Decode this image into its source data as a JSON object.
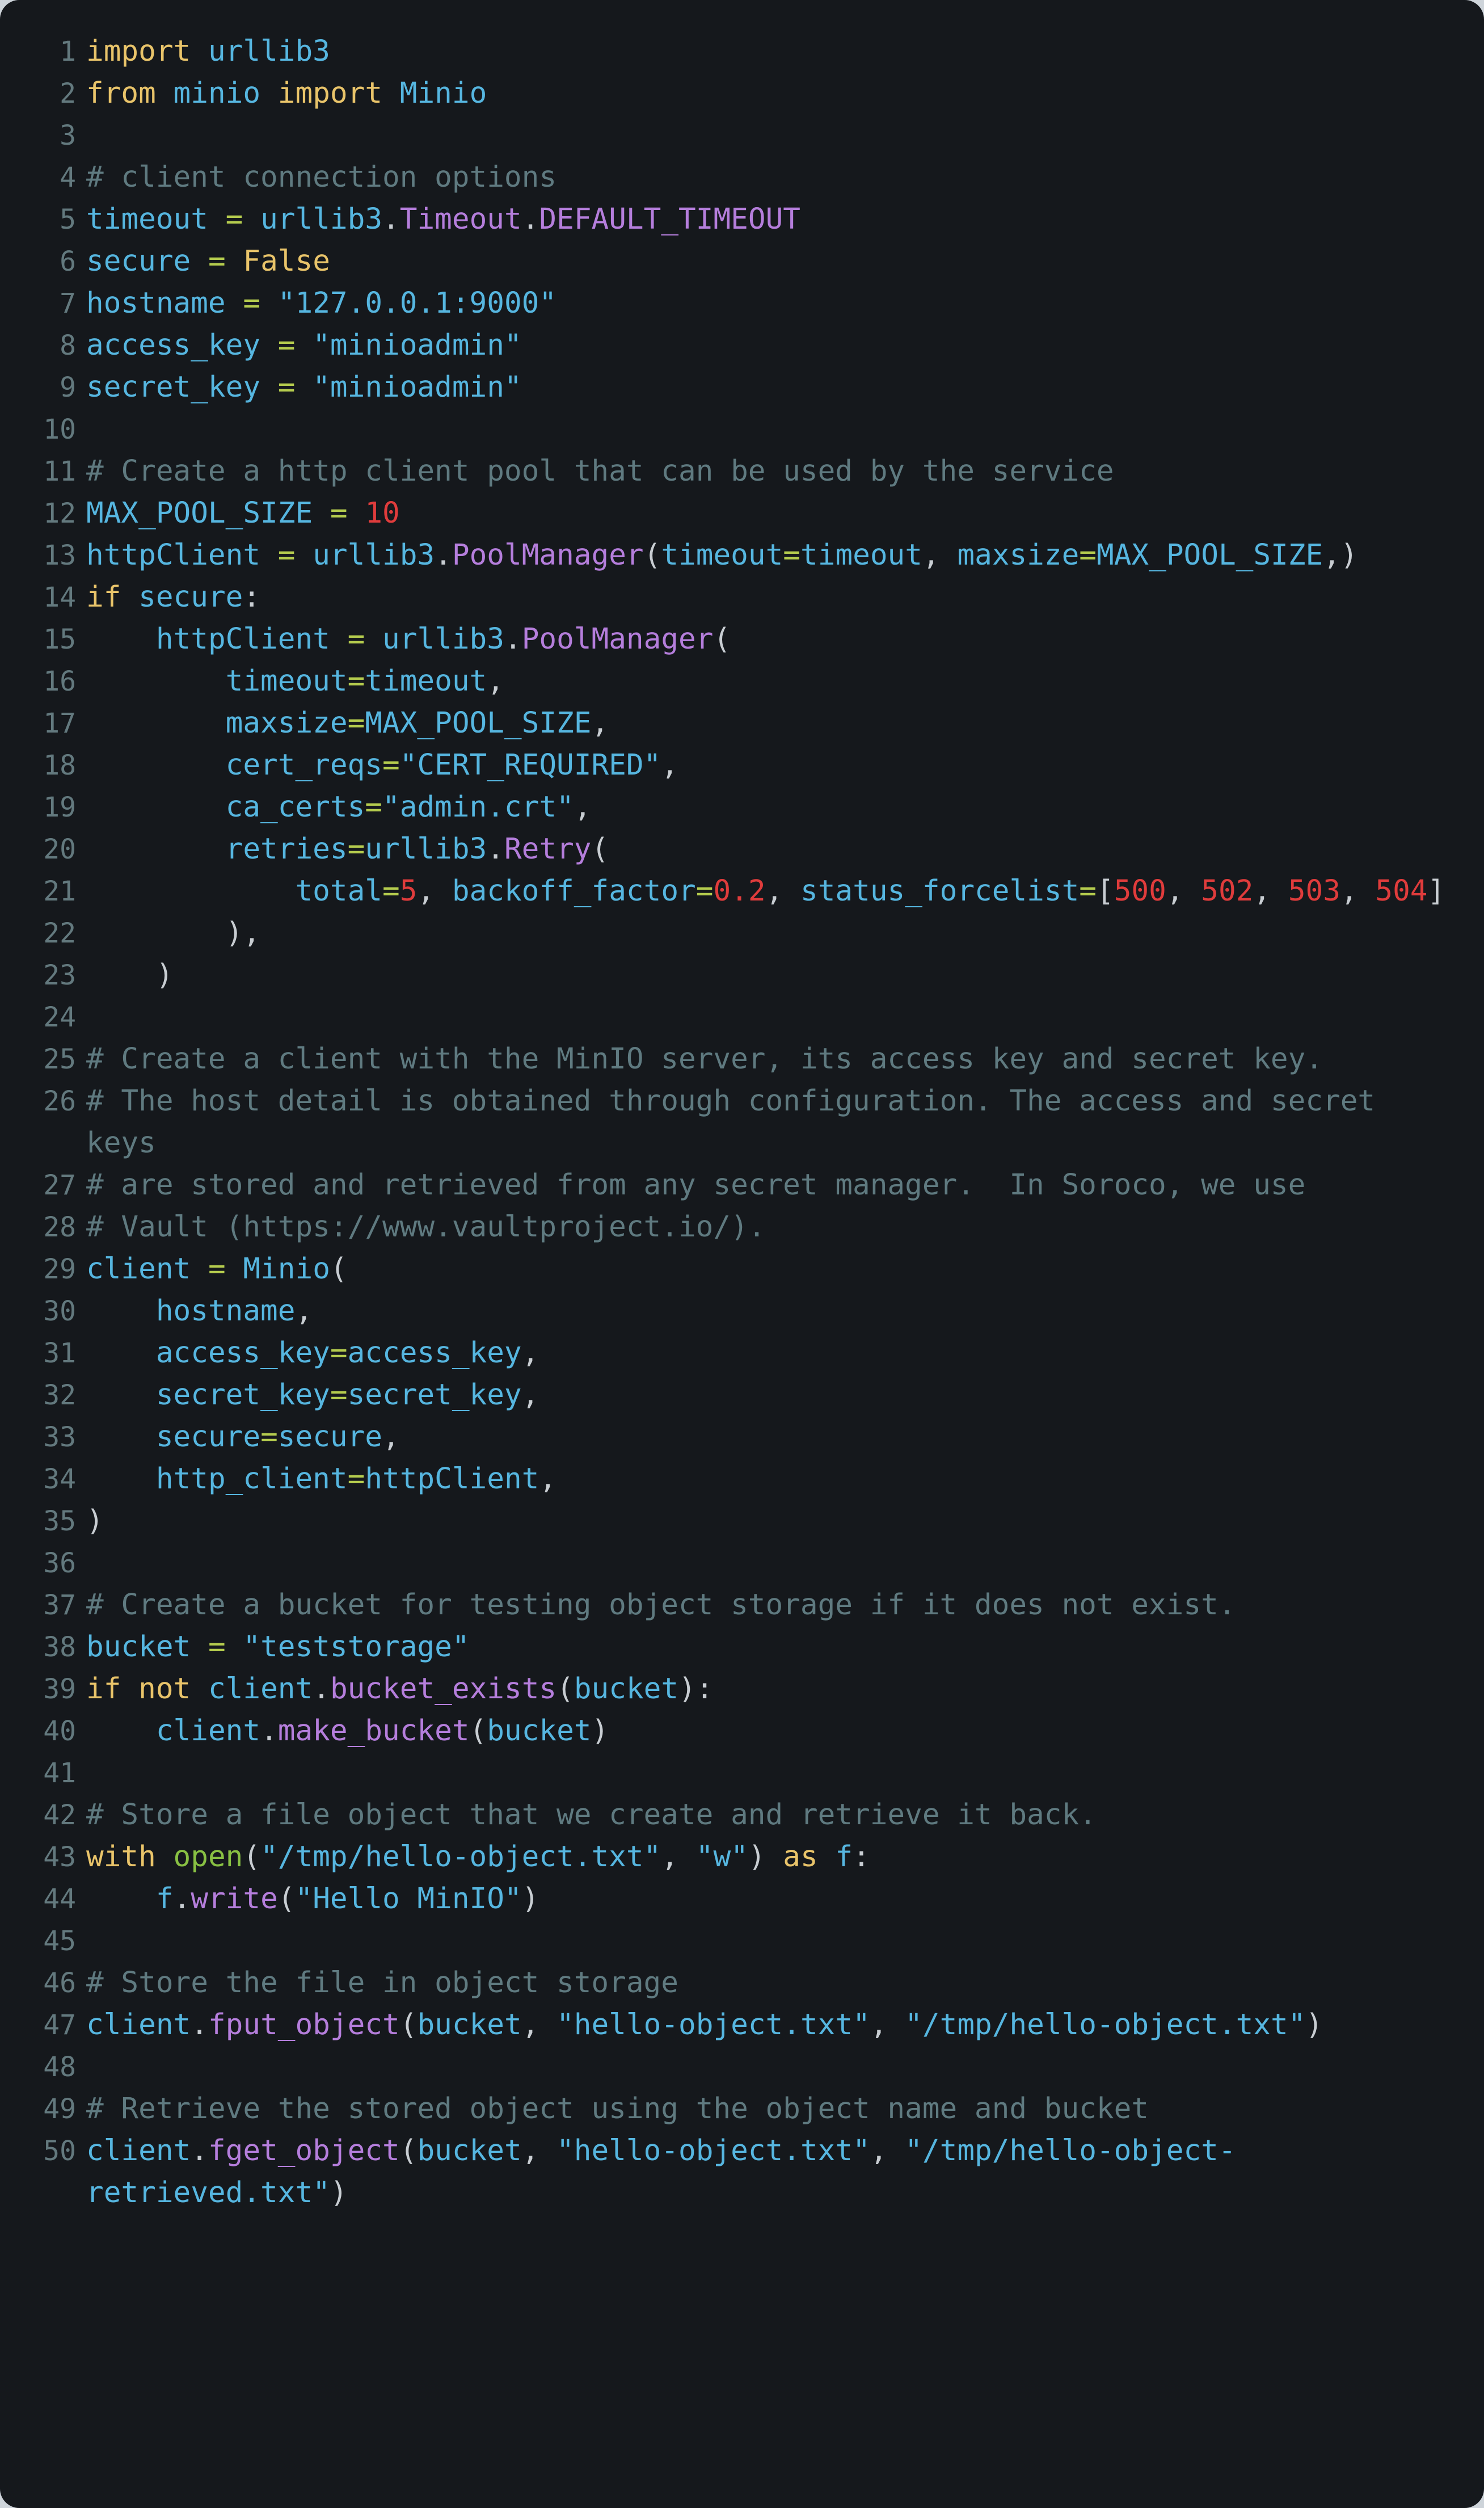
{
  "theme": {
    "background": "#15181c",
    "page_background": "#ced4da",
    "gutter_color": "#63797e",
    "comment": "#5f7a80",
    "keyword": "#e9c46a",
    "name": "#56b6e0",
    "string": "#56b6e0",
    "operator": "#b5cc4e",
    "punctuation": "#c8cdd2",
    "attribute": "#b57edc",
    "number": "#e03c3c",
    "builtin": "#88c043"
  },
  "code": {
    "language": "python",
    "first_line": 1,
    "last_line": 50,
    "lines": [
      {
        "n": "1",
        "text": "import urllib3"
      },
      {
        "n": "2",
        "text": "from minio import Minio"
      },
      {
        "n": "3",
        "text": ""
      },
      {
        "n": "4",
        "text": "# client connection options"
      },
      {
        "n": "5",
        "text": "timeout = urllib3.Timeout.DEFAULT_TIMEOUT"
      },
      {
        "n": "6",
        "text": "secure = False"
      },
      {
        "n": "7",
        "text": "hostname = \"127.0.0.1:9000\""
      },
      {
        "n": "8",
        "text": "access_key = \"minioadmin\""
      },
      {
        "n": "9",
        "text": "secret_key = \"minioadmin\""
      },
      {
        "n": "10",
        "text": ""
      },
      {
        "n": "11",
        "text": "# Create a http client pool that can be used by the service"
      },
      {
        "n": "12",
        "text": "MAX_POOL_SIZE = 10"
      },
      {
        "n": "13",
        "text": "httpClient = urllib3.PoolManager(timeout=timeout, maxsize=MAX_POOL_SIZE,)"
      },
      {
        "n": "14",
        "text": "if secure:"
      },
      {
        "n": "15",
        "text": "    httpClient = urllib3.PoolManager("
      },
      {
        "n": "16",
        "text": "        timeout=timeout,"
      },
      {
        "n": "17",
        "text": "        maxsize=MAX_POOL_SIZE,"
      },
      {
        "n": "18",
        "text": "        cert_reqs=\"CERT_REQUIRED\","
      },
      {
        "n": "19",
        "text": "        ca_certs=\"admin.crt\","
      },
      {
        "n": "20",
        "text": "        retries=urllib3.Retry("
      },
      {
        "n": "21",
        "text": "            total=5, backoff_factor=0.2, status_forcelist=[500, 502, 503, 504]"
      },
      {
        "n": "22",
        "text": "        ),"
      },
      {
        "n": "23",
        "text": "    )"
      },
      {
        "n": "24",
        "text": ""
      },
      {
        "n": "25",
        "text": "# Create a client with the MinIO server, its access key and secret key."
      },
      {
        "n": "26",
        "text": "# The host detail is obtained through configuration. The access and secret keys"
      },
      {
        "n": "27",
        "text": "# are stored and retrieved from any secret manager.  In Soroco, we use"
      },
      {
        "n": "28",
        "text": "# Vault (https://www.vaultproject.io/)."
      },
      {
        "n": "29",
        "text": "client = Minio("
      },
      {
        "n": "30",
        "text": "    hostname,"
      },
      {
        "n": "31",
        "text": "    access_key=access_key,"
      },
      {
        "n": "32",
        "text": "    secret_key=secret_key,"
      },
      {
        "n": "33",
        "text": "    secure=secure,"
      },
      {
        "n": "34",
        "text": "    http_client=httpClient,"
      },
      {
        "n": "35",
        "text": ")"
      },
      {
        "n": "36",
        "text": ""
      },
      {
        "n": "37",
        "text": "# Create a bucket for testing object storage if it does not exist."
      },
      {
        "n": "38",
        "text": "bucket = \"teststorage\""
      },
      {
        "n": "39",
        "text": "if not client.bucket_exists(bucket):"
      },
      {
        "n": "40",
        "text": "    client.make_bucket(bucket)"
      },
      {
        "n": "41",
        "text": ""
      },
      {
        "n": "42",
        "text": "# Store a file object that we create and retrieve it back."
      },
      {
        "n": "43",
        "text": "with open(\"/tmp/hello-object.txt\", \"w\") as f:"
      },
      {
        "n": "44",
        "text": "    f.write(\"Hello MinIO\")"
      },
      {
        "n": "45",
        "text": ""
      },
      {
        "n": "46",
        "text": "# Store the file in object storage"
      },
      {
        "n": "47",
        "text": "client.fput_object(bucket, \"hello-object.txt\", \"/tmp/hello-object.txt\")"
      },
      {
        "n": "48",
        "text": ""
      },
      {
        "n": "49",
        "text": "# Retrieve the stored object using the object name and bucket"
      },
      {
        "n": "50",
        "text": "client.fget_object(bucket, \"hello-object.txt\", \"/tmp/hello-object-retrieved.txt\")"
      }
    ],
    "tokens": [
      [
        [
          "k",
          "import"
        ],
        [
          "p",
          " "
        ],
        [
          "n",
          "urllib3"
        ]
      ],
      [
        [
          "k",
          "from"
        ],
        [
          "p",
          " "
        ],
        [
          "n",
          "minio"
        ],
        [
          "p",
          " "
        ],
        [
          "k",
          "import"
        ],
        [
          "p",
          " "
        ],
        [
          "n",
          "Minio"
        ]
      ],
      [],
      [
        [
          "c",
          "# client connection options"
        ]
      ],
      [
        [
          "n",
          "timeout"
        ],
        [
          "p",
          " "
        ],
        [
          "o",
          "="
        ],
        [
          "p",
          " "
        ],
        [
          "n",
          "urllib3"
        ],
        [
          "p",
          "."
        ],
        [
          "a",
          "Timeout"
        ],
        [
          "p",
          "."
        ],
        [
          "a",
          "DEFAULT_TIMEOUT"
        ]
      ],
      [
        [
          "n",
          "secure"
        ],
        [
          "p",
          " "
        ],
        [
          "o",
          "="
        ],
        [
          "p",
          " "
        ],
        [
          "kc",
          "False"
        ]
      ],
      [
        [
          "n",
          "hostname"
        ],
        [
          "p",
          " "
        ],
        [
          "o",
          "="
        ],
        [
          "p",
          " "
        ],
        [
          "s",
          "\"127.0.0.1:9000\""
        ]
      ],
      [
        [
          "n",
          "access_key"
        ],
        [
          "p",
          " "
        ],
        [
          "o",
          "="
        ],
        [
          "p",
          " "
        ],
        [
          "s",
          "\"minioadmin\""
        ]
      ],
      [
        [
          "n",
          "secret_key"
        ],
        [
          "p",
          " "
        ],
        [
          "o",
          "="
        ],
        [
          "p",
          " "
        ],
        [
          "s",
          "\"minioadmin\""
        ]
      ],
      [],
      [
        [
          "c",
          "# Create a http client pool that can be used by the service"
        ]
      ],
      [
        [
          "n",
          "MAX_POOL_SIZE"
        ],
        [
          "p",
          " "
        ],
        [
          "o",
          "="
        ],
        [
          "p",
          " "
        ],
        [
          "m",
          "10"
        ]
      ],
      [
        [
          "n",
          "httpClient"
        ],
        [
          "p",
          " "
        ],
        [
          "o",
          "="
        ],
        [
          "p",
          " "
        ],
        [
          "n",
          "urllib3"
        ],
        [
          "p",
          "."
        ],
        [
          "a",
          "PoolManager"
        ],
        [
          "p",
          "("
        ],
        [
          "n",
          "timeout"
        ],
        [
          "o",
          "="
        ],
        [
          "n",
          "timeout"
        ],
        [
          "p",
          ", "
        ],
        [
          "n",
          "maxsize"
        ],
        [
          "o",
          "="
        ],
        [
          "n",
          "MAX_POOL_SIZE"
        ],
        [
          "p",
          ",)"
        ]
      ],
      [
        [
          "k",
          "if"
        ],
        [
          "p",
          " "
        ],
        [
          "n",
          "secure"
        ],
        [
          "p",
          ":"
        ]
      ],
      [
        [
          "p",
          "    "
        ],
        [
          "n",
          "httpClient"
        ],
        [
          "p",
          " "
        ],
        [
          "o",
          "="
        ],
        [
          "p",
          " "
        ],
        [
          "n",
          "urllib3"
        ],
        [
          "p",
          "."
        ],
        [
          "a",
          "PoolManager"
        ],
        [
          "p",
          "("
        ]
      ],
      [
        [
          "p",
          "        "
        ],
        [
          "n",
          "timeout"
        ],
        [
          "o",
          "="
        ],
        [
          "n",
          "timeout"
        ],
        [
          "p",
          ","
        ]
      ],
      [
        [
          "p",
          "        "
        ],
        [
          "n",
          "maxsize"
        ],
        [
          "o",
          "="
        ],
        [
          "n",
          "MAX_POOL_SIZE"
        ],
        [
          "p",
          ","
        ]
      ],
      [
        [
          "p",
          "        "
        ],
        [
          "n",
          "cert_reqs"
        ],
        [
          "o",
          "="
        ],
        [
          "s",
          "\"CERT_REQUIRED\""
        ],
        [
          "p",
          ","
        ]
      ],
      [
        [
          "p",
          "        "
        ],
        [
          "n",
          "ca_certs"
        ],
        [
          "o",
          "="
        ],
        [
          "s",
          "\"admin.crt\""
        ],
        [
          "p",
          ","
        ]
      ],
      [
        [
          "p",
          "        "
        ],
        [
          "n",
          "retries"
        ],
        [
          "o",
          "="
        ],
        [
          "n",
          "urllib3"
        ],
        [
          "p",
          "."
        ],
        [
          "a",
          "Retry"
        ],
        [
          "p",
          "("
        ]
      ],
      [
        [
          "p",
          "            "
        ],
        [
          "n",
          "total"
        ],
        [
          "o",
          "="
        ],
        [
          "m",
          "5"
        ],
        [
          "p",
          ", "
        ],
        [
          "n",
          "backoff_factor"
        ],
        [
          "o",
          "="
        ],
        [
          "m",
          "0.2"
        ],
        [
          "p",
          ", "
        ],
        [
          "n",
          "status_forcelist"
        ],
        [
          "o",
          "="
        ],
        [
          "p",
          "["
        ],
        [
          "m",
          "500"
        ],
        [
          "p",
          ", "
        ],
        [
          "m",
          "502"
        ],
        [
          "p",
          ", "
        ],
        [
          "m",
          "503"
        ],
        [
          "p",
          ", "
        ],
        [
          "m",
          "504"
        ],
        [
          "p",
          "]"
        ]
      ],
      [
        [
          "p",
          "        ),"
        ]
      ],
      [
        [
          "p",
          "    )"
        ]
      ],
      [],
      [
        [
          "c",
          "# Create a client with the MinIO server, its access key and secret key."
        ]
      ],
      [
        [
          "c",
          "# The host detail is obtained through configuration. The access and secret keys"
        ]
      ],
      [
        [
          "c",
          "# are stored and retrieved from any secret manager.  In Soroco, we use"
        ]
      ],
      [
        [
          "c",
          "# Vault (https://www.vaultproject.io/)."
        ]
      ],
      [
        [
          "n",
          "client"
        ],
        [
          "p",
          " "
        ],
        [
          "o",
          "="
        ],
        [
          "p",
          " "
        ],
        [
          "n",
          "Minio"
        ],
        [
          "p",
          "("
        ]
      ],
      [
        [
          "p",
          "    "
        ],
        [
          "n",
          "hostname"
        ],
        [
          "p",
          ","
        ]
      ],
      [
        [
          "p",
          "    "
        ],
        [
          "n",
          "access_key"
        ],
        [
          "o",
          "="
        ],
        [
          "n",
          "access_key"
        ],
        [
          "p",
          ","
        ]
      ],
      [
        [
          "p",
          "    "
        ],
        [
          "n",
          "secret_key"
        ],
        [
          "o",
          "="
        ],
        [
          "n",
          "secret_key"
        ],
        [
          "p",
          ","
        ]
      ],
      [
        [
          "p",
          "    "
        ],
        [
          "n",
          "secure"
        ],
        [
          "o",
          "="
        ],
        [
          "n",
          "secure"
        ],
        [
          "p",
          ","
        ]
      ],
      [
        [
          "p",
          "    "
        ],
        [
          "n",
          "http_client"
        ],
        [
          "o",
          "="
        ],
        [
          "n",
          "httpClient"
        ],
        [
          "p",
          ","
        ]
      ],
      [
        [
          "p",
          ")"
        ]
      ],
      [],
      [
        [
          "c",
          "# Create a bucket for testing object storage if it does not exist."
        ]
      ],
      [
        [
          "n",
          "bucket"
        ],
        [
          "p",
          " "
        ],
        [
          "o",
          "="
        ],
        [
          "p",
          " "
        ],
        [
          "s",
          "\"teststorage\""
        ]
      ],
      [
        [
          "k",
          "if"
        ],
        [
          "p",
          " "
        ],
        [
          "k",
          "not"
        ],
        [
          "p",
          " "
        ],
        [
          "n",
          "client"
        ],
        [
          "p",
          "."
        ],
        [
          "a",
          "bucket_exists"
        ],
        [
          "p",
          "("
        ],
        [
          "n",
          "bucket"
        ],
        [
          "p",
          "):"
        ]
      ],
      [
        [
          "p",
          "    "
        ],
        [
          "n",
          "client"
        ],
        [
          "p",
          "."
        ],
        [
          "a",
          "make_bucket"
        ],
        [
          "p",
          "("
        ],
        [
          "n",
          "bucket"
        ],
        [
          "p",
          ")"
        ]
      ],
      [],
      [
        [
          "c",
          "# Store a file object that we create and retrieve it back."
        ]
      ],
      [
        [
          "k",
          "with"
        ],
        [
          "p",
          " "
        ],
        [
          "b",
          "open"
        ],
        [
          "p",
          "("
        ],
        [
          "s",
          "\"/tmp/hello-object.txt\""
        ],
        [
          "p",
          ", "
        ],
        [
          "s",
          "\"w\""
        ],
        [
          "p",
          ") "
        ],
        [
          "k",
          "as"
        ],
        [
          "p",
          " "
        ],
        [
          "n",
          "f"
        ],
        [
          "p",
          ":"
        ]
      ],
      [
        [
          "p",
          "    "
        ],
        [
          "n",
          "f"
        ],
        [
          "p",
          "."
        ],
        [
          "a",
          "write"
        ],
        [
          "p",
          "("
        ],
        [
          "s",
          "\"Hello MinIO\""
        ],
        [
          "p",
          ")"
        ]
      ],
      [],
      [
        [
          "c",
          "# Store the file in object storage"
        ]
      ],
      [
        [
          "n",
          "client"
        ],
        [
          "p",
          "."
        ],
        [
          "a",
          "fput_object"
        ],
        [
          "p",
          "("
        ],
        [
          "n",
          "bucket"
        ],
        [
          "p",
          ", "
        ],
        [
          "s",
          "\"hello-object.txt\""
        ],
        [
          "p",
          ", "
        ],
        [
          "s",
          "\"/tmp/hello-object.txt\""
        ],
        [
          "p",
          ")"
        ]
      ],
      [],
      [
        [
          "c",
          "# Retrieve the stored object using the object name and bucket"
        ]
      ],
      [
        [
          "n",
          "client"
        ],
        [
          "p",
          "."
        ],
        [
          "a",
          "fget_object"
        ],
        [
          "p",
          "("
        ],
        [
          "n",
          "bucket"
        ],
        [
          "p",
          ", "
        ],
        [
          "s",
          "\"hello-object.txt\""
        ],
        [
          "p",
          ", "
        ],
        [
          "s",
          "\"/tmp/hello-object-retrieved.txt\""
        ],
        [
          "p",
          ")"
        ]
      ]
    ]
  }
}
